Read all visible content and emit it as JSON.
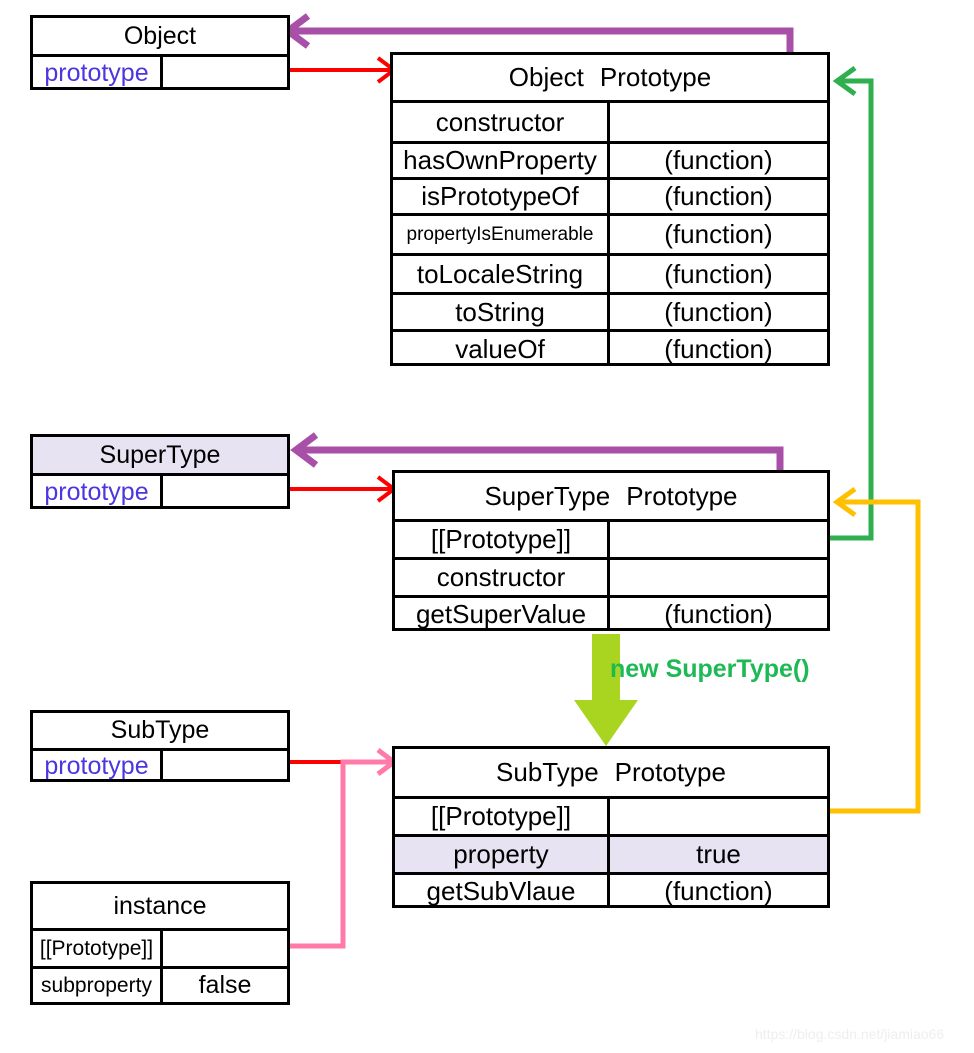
{
  "diagram": {
    "title": "JavaScript prototype chain diagram",
    "watermark": "https://blog.csdn.net/jiamiao66"
  },
  "colors": {
    "red": "#ff0000",
    "purple": "#a84fa8",
    "green": "#2faf4e",
    "orange": "#ffc000",
    "pink": "#ff7aa8",
    "lime": "#a9d41f",
    "label_green": "#1db954",
    "prototype_text": "#4b36e0",
    "lavender_fill": "#e7e3f3",
    "stroke": "#000000"
  },
  "boxes": {
    "object": {
      "title": "Object",
      "key": "prototype",
      "value": "",
      "title_shaded": false
    },
    "supertype": {
      "title": "SuperType",
      "key": "prototype",
      "value": "",
      "title_shaded": true
    },
    "subtype": {
      "title": "SubType",
      "key": "prototype",
      "value": "",
      "title_shaded": false
    },
    "instance": {
      "title": "instance",
      "rows": [
        {
          "name": "[[Prototype]]",
          "value": ""
        },
        {
          "name": "subproperty",
          "value": "false"
        }
      ]
    }
  },
  "tables": {
    "object_prototype": {
      "header_left": "Object",
      "header_right": "Prototype",
      "rows": [
        {
          "name": "constructor",
          "value": "",
          "shaded": false,
          "small": false
        },
        {
          "name": "hasOwnProperty",
          "value": "(function)",
          "shaded": false,
          "small": false
        },
        {
          "name": "isPrototypeOf",
          "value": "(function)",
          "shaded": false,
          "small": false
        },
        {
          "name": "propertyIsEnumerable",
          "value": "(function)",
          "shaded": false,
          "small": true
        },
        {
          "name": "toLocaleString",
          "value": "(function)",
          "shaded": false,
          "small": false
        },
        {
          "name": "toString",
          "value": "(function)",
          "shaded": false,
          "small": false
        },
        {
          "name": "valueOf",
          "value": "(function)",
          "shaded": false,
          "small": false
        }
      ]
    },
    "supertype_prototype": {
      "header_left": "SuperType",
      "header_right": "Prototype",
      "rows": [
        {
          "name": "[[Prototype]]",
          "value": "",
          "shaded": false,
          "small": false
        },
        {
          "name": "constructor",
          "value": "",
          "shaded": false,
          "small": false
        },
        {
          "name": "getSuperValue",
          "value": "(function)",
          "shaded": false,
          "small": false
        }
      ]
    },
    "subtype_prototype": {
      "header_left": "SubType",
      "header_right": "Prototype",
      "rows": [
        {
          "name": "[[Prototype]]",
          "value": "",
          "shaded": false,
          "small": false
        },
        {
          "name": "property",
          "value": "true",
          "shaded": true,
          "small": false
        },
        {
          "name": "getSubVlaue",
          "value": "(function)",
          "shaded": false,
          "small": false
        }
      ]
    }
  },
  "annotations": {
    "new_supertype": "new SuperType()"
  }
}
